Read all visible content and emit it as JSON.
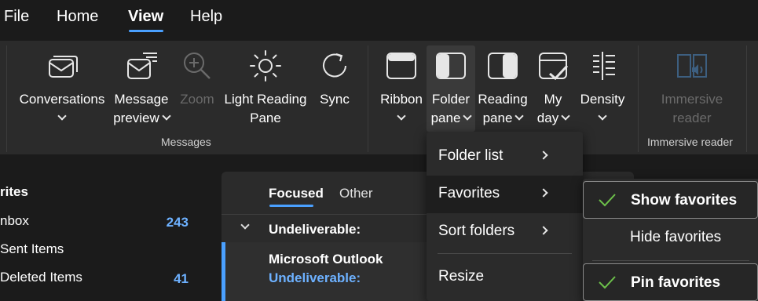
{
  "menubar": {
    "tabs": [
      {
        "label": "File"
      },
      {
        "label": "Home"
      },
      {
        "label": "View",
        "active": true
      },
      {
        "label": "Help"
      }
    ]
  },
  "ribbon": {
    "messages_group": {
      "label": "Messages",
      "buttons": [
        {
          "line1": "Conversations",
          "line2": ""
        },
        {
          "line1": "Message",
          "line2": "preview"
        },
        {
          "line1": "Zoom",
          "line2": "",
          "disabled": true
        },
        {
          "line1": "Light Reading",
          "line2": "Pane"
        },
        {
          "line1": "Sync",
          "line2": ""
        }
      ]
    },
    "layout_group": {
      "buttons": [
        {
          "line1": "Ribbon",
          "line2": ""
        },
        {
          "line1": "Folder",
          "line2": "pane",
          "selected": true
        },
        {
          "line1": "Reading",
          "line2": "pane"
        },
        {
          "line1": "My",
          "line2": "day"
        },
        {
          "line1": "Density",
          "line2": ""
        }
      ]
    },
    "immersive_group": {
      "label": "Immersive reader",
      "button": {
        "line1": "Immersive",
        "line2": "reader",
        "disabled": true
      }
    }
  },
  "folder_pane": {
    "section_title": "rites",
    "items": [
      {
        "label": "nbox",
        "count": "243"
      },
      {
        "label": "Sent Items",
        "count": ""
      },
      {
        "label": "Deleted Items",
        "count": "41"
      }
    ]
  },
  "message_list": {
    "tabs": {
      "focused": "Focused",
      "other": "Other"
    },
    "group_header": "Undeliverable:",
    "item": {
      "sender": "Microsoft Outlook",
      "subject": "Undeliverable:"
    }
  },
  "folder_pane_menu": {
    "items": [
      {
        "label": "Folder list",
        "has_submenu": true
      },
      {
        "label": "Favorites",
        "has_submenu": true,
        "highlighted": true
      },
      {
        "label": "Sort folders",
        "has_submenu": true
      },
      {
        "label": "Resize",
        "has_submenu": false
      }
    ]
  },
  "favorites_submenu": {
    "items": [
      {
        "label": "Show favorites",
        "checked": true
      },
      {
        "label": "Hide favorites",
        "checked": false
      },
      {
        "label": "Pin favorites",
        "checked": true
      }
    ]
  },
  "colors": {
    "accent": "#4aa0ff",
    "count_blue": "#6db1ff",
    "check_green": "#6cc04a",
    "background": "#1b1b1b",
    "ribbon_bg": "#2b2b2b"
  }
}
